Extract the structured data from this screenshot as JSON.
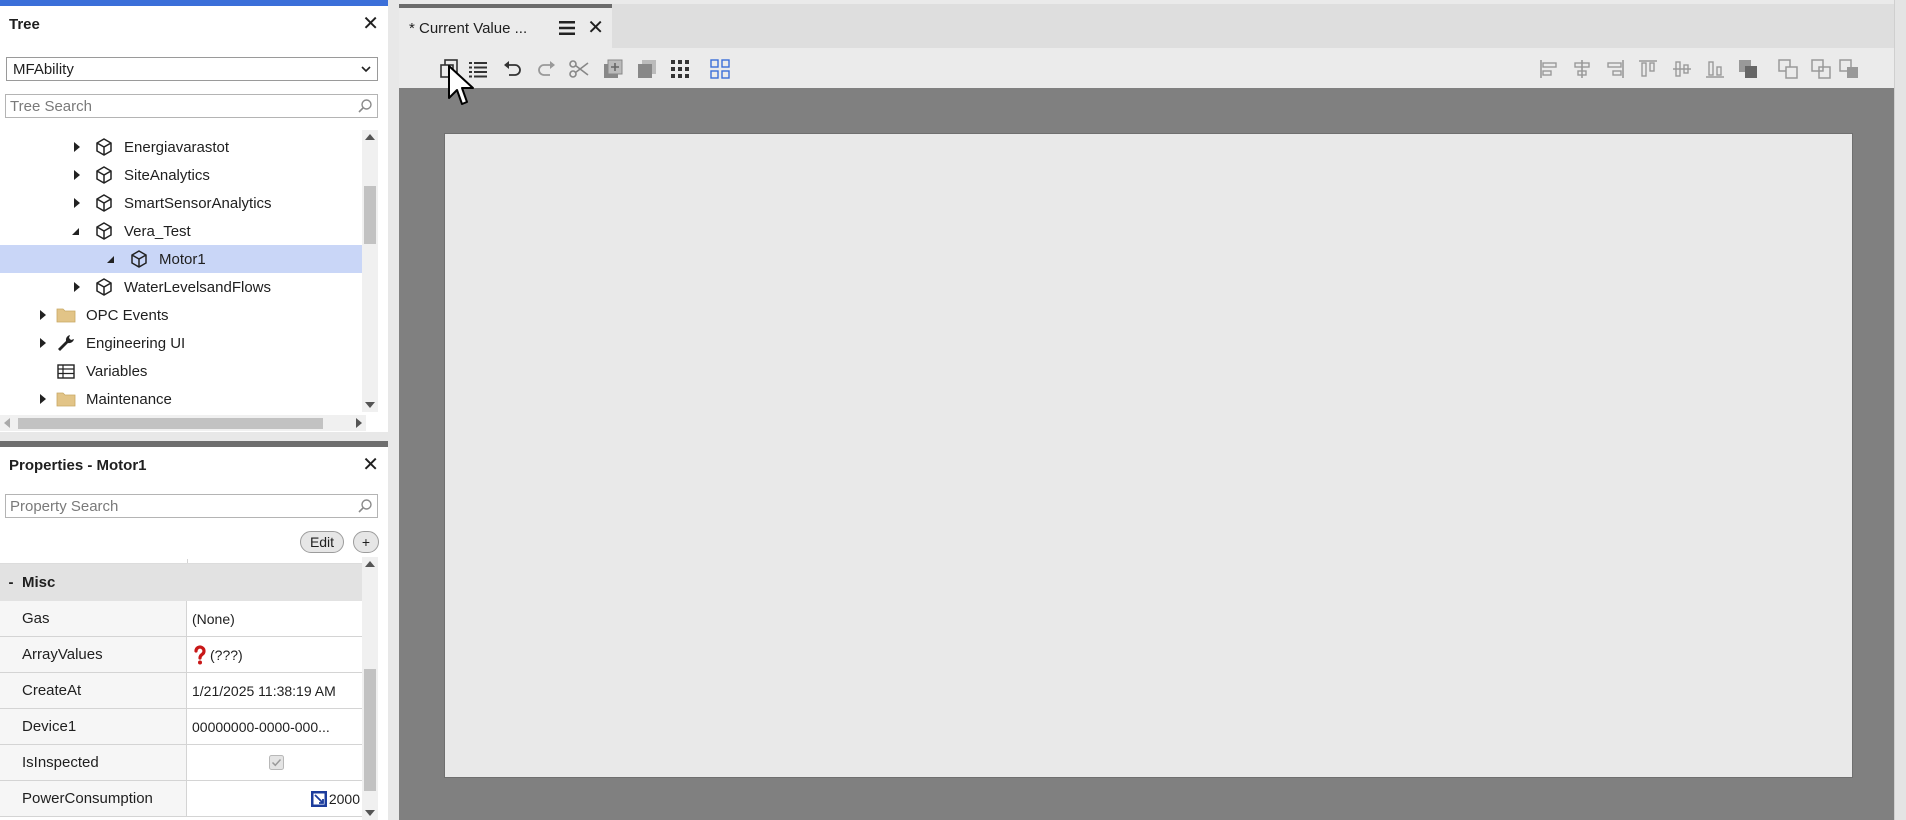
{
  "tree_panel": {
    "title": "Tree",
    "dropdown_value": "MFAbility",
    "search_placeholder": "Tree Search",
    "items": [
      {
        "label": "Energiavarastot",
        "type": "object",
        "expander": "collapsed"
      },
      {
        "label": "SiteAnalytics",
        "type": "object",
        "expander": "collapsed"
      },
      {
        "label": "SmartSensorAnalytics",
        "type": "object",
        "expander": "collapsed"
      },
      {
        "label": "Vera_Test",
        "type": "object",
        "expander": "expanded"
      },
      {
        "label": "Motor1",
        "type": "object",
        "expander": "expanded",
        "selected": true
      },
      {
        "label": "WaterLevelsandFlows",
        "type": "object",
        "expander": "collapsed"
      },
      {
        "label": "OPC Events",
        "type": "folder",
        "expander": "collapsed"
      },
      {
        "label": "Engineering UI",
        "type": "wrench",
        "expander": "collapsed"
      },
      {
        "label": "Variables",
        "type": "table",
        "expander": "none"
      },
      {
        "label": "Maintenance",
        "type": "folder",
        "expander": "collapsed"
      }
    ]
  },
  "properties_panel": {
    "title": "Properties - Motor1",
    "search_placeholder": "Property Search",
    "edit_label": "Edit",
    "add_label": "+",
    "group_toggle": "-",
    "group_label": "Misc",
    "rows": [
      {
        "name": "Gas",
        "value": "(None)"
      },
      {
        "name": "ArrayValues",
        "value": "(???)"
      },
      {
        "name": "CreateAt",
        "value": "1/21/2025 11:38:19 AM"
      },
      {
        "name": "Device1",
        "value": "00000000-0000-000..."
      },
      {
        "name": "IsInspected",
        "value": ""
      },
      {
        "name": "PowerConsumption",
        "value": "2000"
      }
    ]
  },
  "editor": {
    "tab_title": "* Current Value ...",
    "toolbar_left": [
      "copy-icon",
      "list-icon",
      "undo-icon",
      "redo-icon",
      "cut-icon",
      "bring-forward-icon",
      "send-backward-icon",
      "grid-dots-icon",
      "snap-grid-icon"
    ],
    "toolbar_right": [
      "align-left-icon",
      "align-center-icon",
      "align-right-icon",
      "align-top-icon",
      "align-middle-icon",
      "align-bottom-icon",
      "order-icon",
      "group-icon",
      "ungroup-icon",
      "arrange-icon"
    ]
  },
  "colors": {
    "accent": "#3b6fd9",
    "selection": "#c9d6f7",
    "canvas_backdrop": "#808080"
  }
}
